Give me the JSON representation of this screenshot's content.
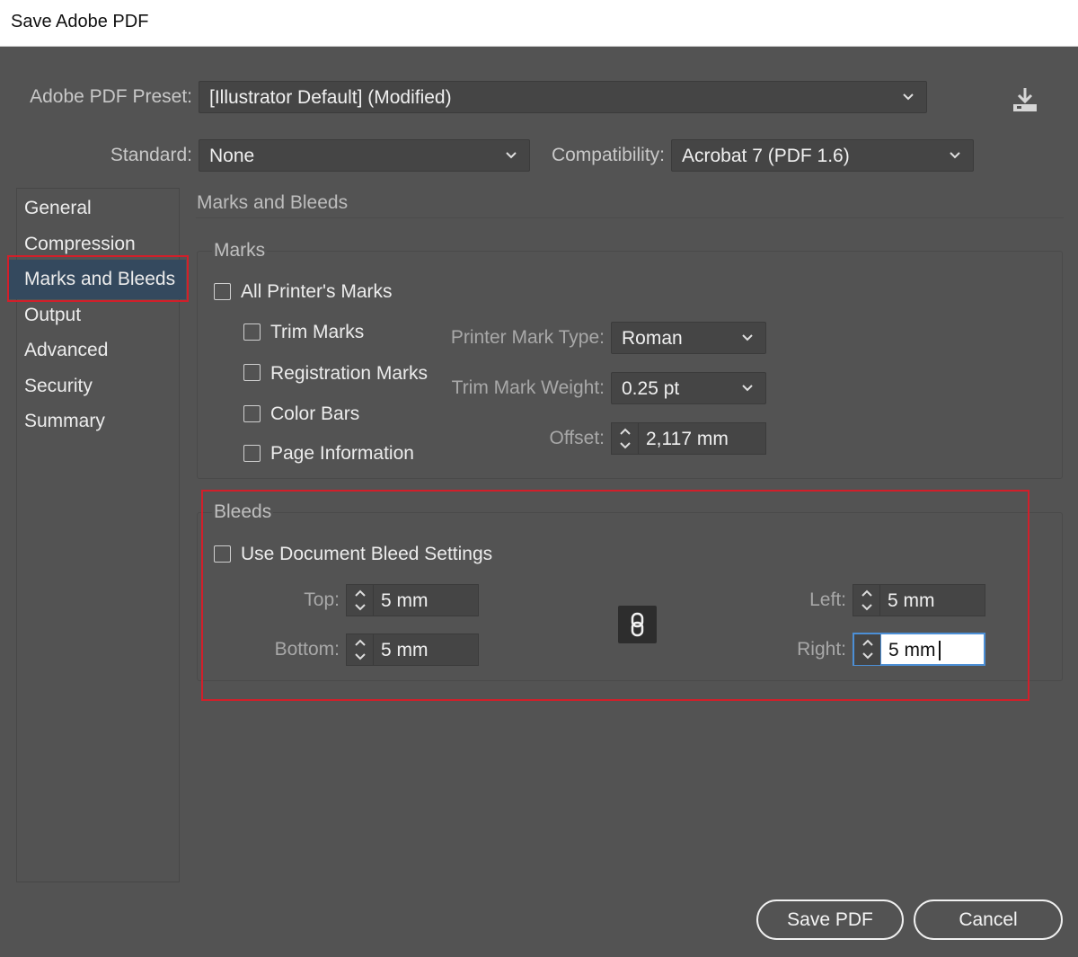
{
  "window": {
    "title": "Save Adobe PDF"
  },
  "preset": {
    "label": "Adobe PDF Preset:",
    "value": "[Illustrator Default] (Modified)",
    "save_icon": "save-preset-icon"
  },
  "standard": {
    "label": "Standard:",
    "value": "None"
  },
  "compatibility": {
    "label": "Compatibility:",
    "value": "Acrobat 7 (PDF 1.6)"
  },
  "sidebar": {
    "items": [
      {
        "label": "General"
      },
      {
        "label": "Compression"
      },
      {
        "label": "Marks and Bleeds",
        "selected": true
      },
      {
        "label": "Output"
      },
      {
        "label": "Advanced"
      },
      {
        "label": "Security"
      },
      {
        "label": "Summary"
      }
    ]
  },
  "section": {
    "title": "Marks and Bleeds"
  },
  "marks": {
    "title": "Marks",
    "all_printers_marks": {
      "label": "All Printer's Marks",
      "checked": false
    },
    "trim_marks": {
      "label": "Trim Marks",
      "checked": false
    },
    "registration_marks": {
      "label": "Registration Marks",
      "checked": false
    },
    "color_bars": {
      "label": "Color Bars",
      "checked": false
    },
    "page_information": {
      "label": "Page Information",
      "checked": false
    },
    "printer_mark_type": {
      "label": "Printer Mark Type:",
      "value": "Roman"
    },
    "trim_mark_weight": {
      "label": "Trim Mark Weight:",
      "value": "0.25 pt"
    },
    "offset": {
      "label": "Offset:",
      "value": "2,117 mm"
    }
  },
  "bleeds": {
    "title": "Bleeds",
    "use_document_bleed": {
      "label": "Use Document Bleed Settings",
      "checked": false
    },
    "top": {
      "label": "Top:",
      "value": "5 mm"
    },
    "bottom": {
      "label": "Bottom:",
      "value": "5 mm"
    },
    "left": {
      "label": "Left:",
      "value": "5 mm"
    },
    "right": {
      "label": "Right:",
      "value": "5 mm"
    },
    "link_icon": "chain-link-icon"
  },
  "buttons": {
    "save": "Save PDF",
    "cancel": "Cancel"
  },
  "colors": {
    "background": "#535353",
    "field": "#454545",
    "highlight_red": "#d21f2a",
    "selection": "#34495e",
    "focus_blue": "#4c8fd6"
  }
}
